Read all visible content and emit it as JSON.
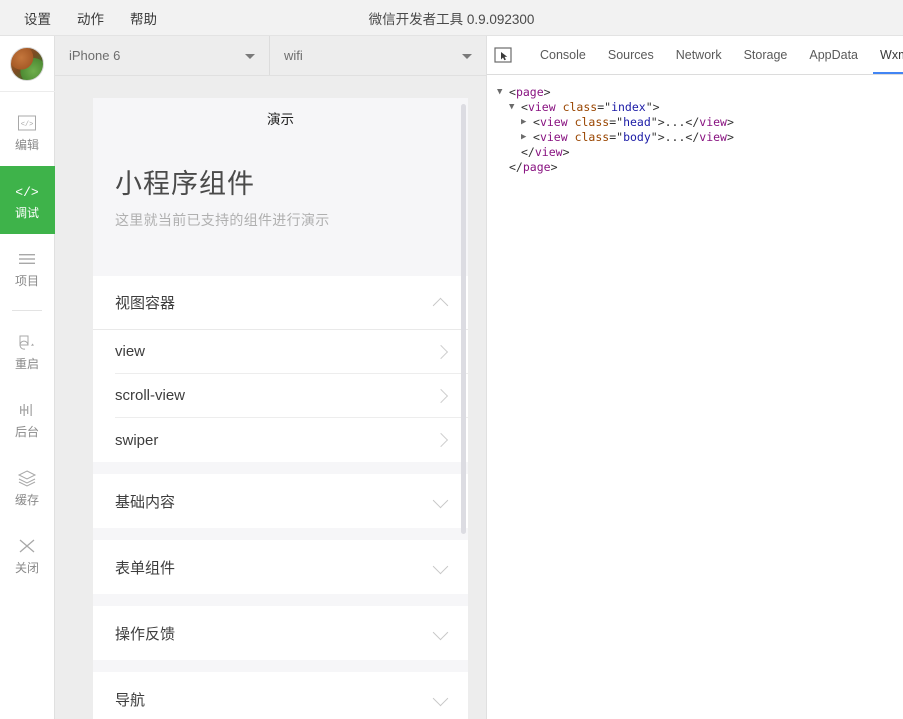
{
  "window": {
    "title": "微信开发者工具 0.9.092300"
  },
  "menubar": {
    "items": [
      {
        "label": "设置",
        "name": "menu-settings"
      },
      {
        "label": "动作",
        "name": "menu-actions"
      },
      {
        "label": "帮助",
        "name": "menu-help"
      }
    ]
  },
  "rail": {
    "avatar_alt": "user-avatar",
    "top_items": [
      {
        "label": "编辑",
        "icon": "code-square-icon",
        "active": false
      },
      {
        "label": "调试",
        "icon": "code-brackets-icon",
        "active": true
      },
      {
        "label": "项目",
        "icon": "hamburger-lines-icon",
        "active": false
      }
    ],
    "bottom_items": [
      {
        "label": "重启",
        "icon": "restart-icon",
        "active": false
      },
      {
        "label": "后台",
        "icon": "background-icon",
        "active": false
      },
      {
        "label": "缓存",
        "icon": "layers-icon",
        "active": false
      },
      {
        "label": "关闭",
        "icon": "close-x-icon",
        "active": false
      }
    ],
    "active_color": "#3eb34a"
  },
  "simulator": {
    "device_select": {
      "value": "iPhone 6",
      "name": "device-select"
    },
    "network_select": {
      "value": "wifi",
      "name": "network-select"
    },
    "page": {
      "nav_title": "演示",
      "hero_title": "小程序组件",
      "hero_subtitle": "这里就当前已支持的组件进行演示",
      "groups": [
        {
          "title": "视图容器",
          "expanded": true,
          "items": [
            "view",
            "scroll-view",
            "swiper"
          ]
        },
        {
          "title": "基础内容",
          "expanded": false,
          "items": []
        },
        {
          "title": "表单组件",
          "expanded": false,
          "items": []
        },
        {
          "title": "操作反馈",
          "expanded": false,
          "items": []
        },
        {
          "title": "导航",
          "expanded": false,
          "items": []
        }
      ]
    }
  },
  "devtools": {
    "inspect_icon": "inspect-element-icon",
    "tabs": [
      {
        "label": "Console",
        "active": false
      },
      {
        "label": "Sources",
        "active": false
      },
      {
        "label": "Network",
        "active": false
      },
      {
        "label": "Storage",
        "active": false
      },
      {
        "label": "AppData",
        "active": false
      },
      {
        "label": "Wxml",
        "active": true
      }
    ],
    "active_tab_color": "#4285f4",
    "wxml": {
      "lines": [
        {
          "indent": 0,
          "arrow": "▼",
          "tag": "page",
          "attr": null,
          "value": null,
          "kind": "open"
        },
        {
          "indent": 1,
          "arrow": "▼",
          "tag": "view",
          "attr": "class",
          "value": "index",
          "kind": "open"
        },
        {
          "indent": 2,
          "arrow": "▶",
          "tag": "view",
          "attr": "class",
          "value": "head",
          "kind": "collapsed"
        },
        {
          "indent": 2,
          "arrow": "▶",
          "tag": "view",
          "attr": "class",
          "value": "body",
          "kind": "collapsed"
        },
        {
          "indent": 1,
          "arrow": "",
          "tag": "view",
          "attr": null,
          "value": null,
          "kind": "close"
        },
        {
          "indent": 0,
          "arrow": "",
          "tag": "page",
          "attr": null,
          "value": null,
          "kind": "close"
        }
      ]
    }
  }
}
